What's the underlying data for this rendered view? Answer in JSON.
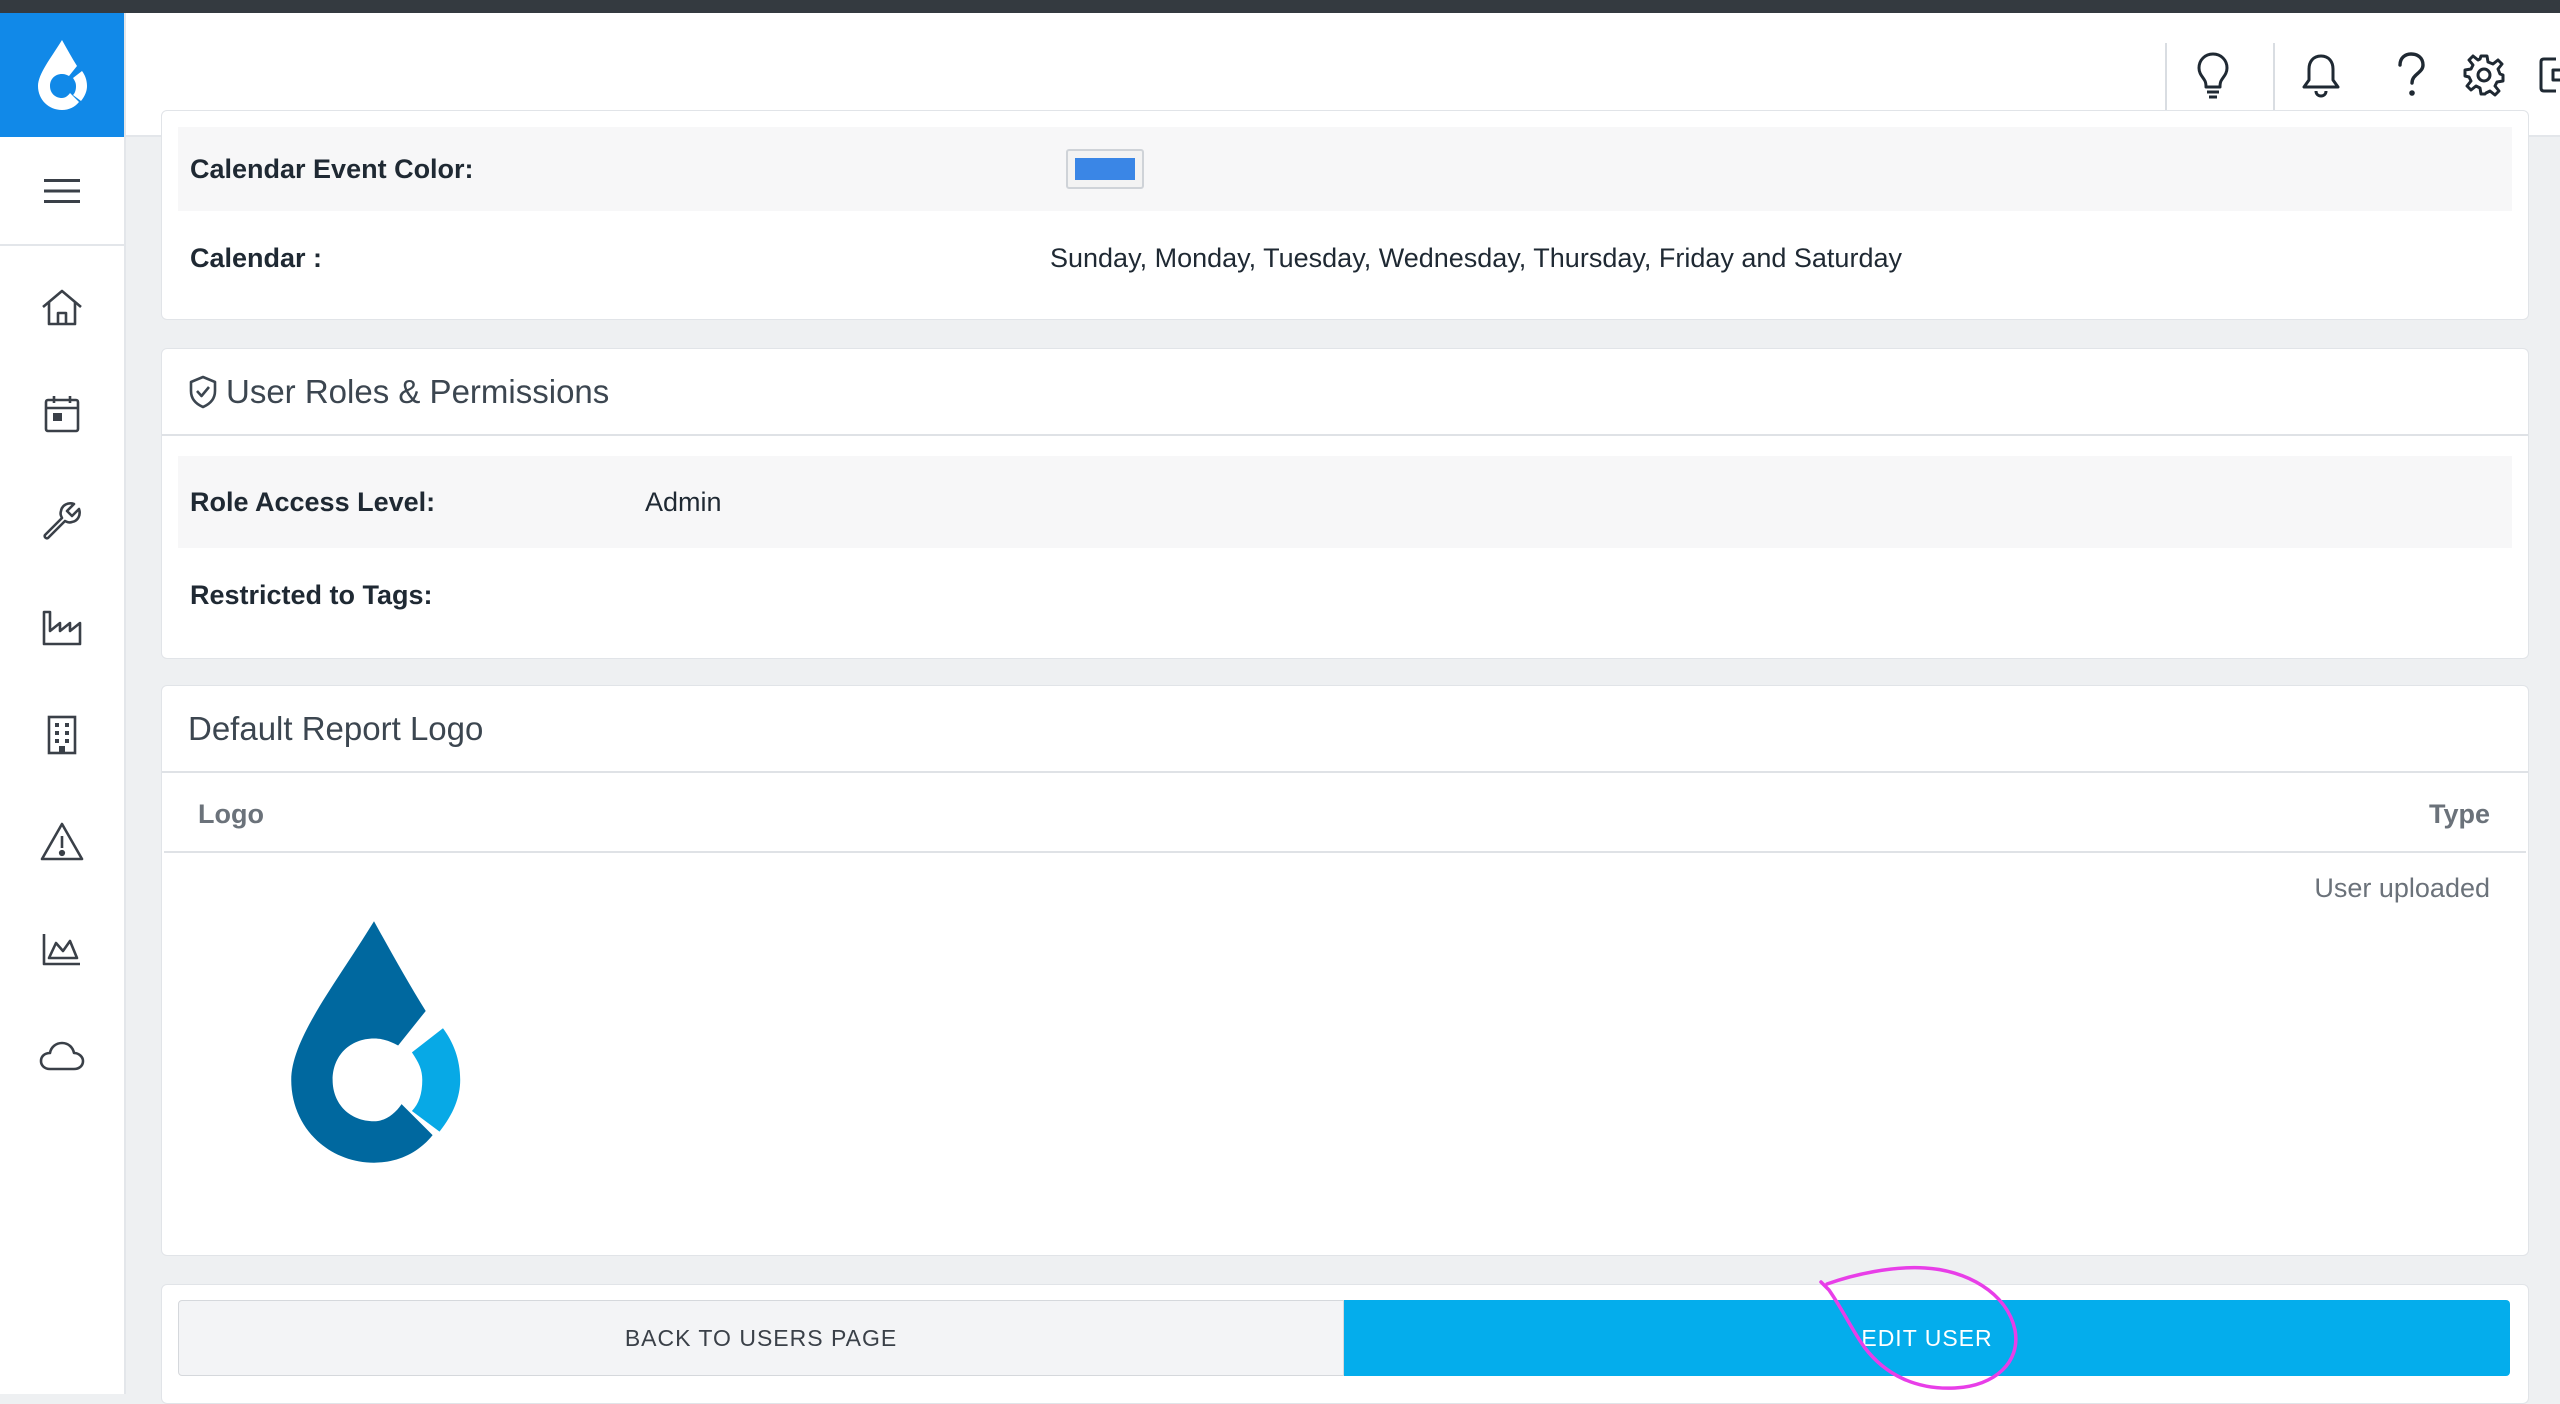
{
  "colors": {
    "brand": "#1189e8",
    "event_color": "#3a86e6",
    "primary_button": "#04adec",
    "logo_dark": "#00689f",
    "logo_light": "#07a9e6",
    "annotation": "#e83ee8"
  },
  "sidebar": {
    "logo_icon": "droplet-logo-icon",
    "menu_icon": "hamburger-icon",
    "items": [
      {
        "icon": "home-icon"
      },
      {
        "icon": "calendar-icon"
      },
      {
        "icon": "wrench-icon"
      },
      {
        "icon": "factory-icon"
      },
      {
        "icon": "building-icon"
      },
      {
        "icon": "warning-icon"
      },
      {
        "icon": "area-chart-icon"
      },
      {
        "icon": "cloud-icon"
      }
    ]
  },
  "header": {
    "icons": [
      "lightbulb-icon",
      "bell-icon",
      "question-icon",
      "gear-icon",
      "logout-icon"
    ]
  },
  "settings": {
    "calendar_event_color_label": "Calendar Event Color:",
    "calendar_label": "Calendar :",
    "calendar_value": "Sunday, Monday, Tuesday, Wednesday, Thursday, Friday and Saturday"
  },
  "roles": {
    "title": "User Roles & Permissions",
    "role_access_label": "Role Access Level:",
    "role_access_value": "Admin",
    "restricted_tags_label": "Restricted to Tags:",
    "restricted_tags_value": ""
  },
  "report_logo": {
    "title": "Default Report Logo",
    "columns": {
      "logo": "Logo",
      "type": "Type"
    },
    "rows": [
      {
        "type": "User uploaded"
      }
    ]
  },
  "actions": {
    "back_label": "BACK TO USERS PAGE",
    "edit_label": "EDIT USER"
  }
}
